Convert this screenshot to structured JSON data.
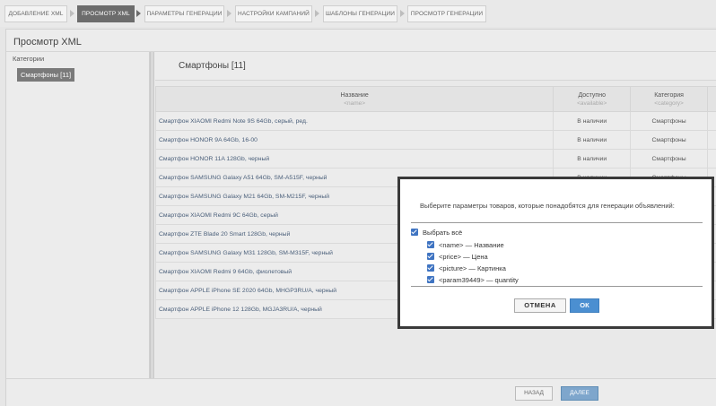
{
  "steps": [
    {
      "label": "ДОБАВЛЕНИЕ XML",
      "active": false
    },
    {
      "label": "ПРОСМОТР XML",
      "active": true
    },
    {
      "label": "ПАРАМЕТРЫ ГЕНЕРАЦИИ",
      "active": false
    },
    {
      "label": "НАСТРОЙКИ КАМПАНИЙ",
      "active": false
    },
    {
      "label": "ШАБЛОНЫ ГЕНЕРАЦИИ",
      "active": false
    },
    {
      "label": "ПРОСМОТР ГЕНЕРАЦИИ",
      "active": false
    }
  ],
  "page_title": "Просмотр XML",
  "sidebar": {
    "label": "Категории",
    "selected_category": "Смартфоны [11]"
  },
  "content": {
    "title": "Смартфоны [11]",
    "columns": [
      {
        "label": "Название",
        "tag": "<name>"
      },
      {
        "label": "Доступно",
        "tag": "<available>"
      },
      {
        "label": "Категория",
        "tag": "<category>"
      }
    ],
    "rows": [
      {
        "name": "Смартфон XIAOMI Redmi Note 9S 64Gb, серый, ред.",
        "available": "В наличии",
        "category": "Смартфоны"
      },
      {
        "name": "Смартфон HONOR 9A 64Gb, 16-00",
        "available": "В наличии",
        "category": "Смартфоны"
      },
      {
        "name": "Смартфон HONOR 11A 128Gb, черный",
        "available": "В наличии",
        "category": "Смартфоны"
      },
      {
        "name": "Смартфон SAMSUNG Galaxy A51 64Gb, SM-A515F, черный",
        "available": "В наличии",
        "category": "Смартфоны"
      },
      {
        "name": "Смартфон SAMSUNG Galaxy M21 64Gb, SM-M215F, черный",
        "available": "",
        "category": ""
      },
      {
        "name": "Смартфон XIAOMI Redmi 9C 64Gb, серый",
        "available": "",
        "category": ""
      },
      {
        "name": "Смартфон ZTE Blade 20 Smart 128Gb, черный",
        "available": "",
        "category": ""
      },
      {
        "name": "Смартфон SAMSUNG Galaxy M31 128Gb, SM-M315F, черный",
        "available": "",
        "category": ""
      },
      {
        "name": "Смартфон XIAOMI Redmi 9 64Gb, фиолетовый",
        "available": "",
        "category": ""
      },
      {
        "name": "Смартфон APPLE iPhone SE 2020 64Gb, MHGP3RU/A, черный",
        "available": "",
        "category": ""
      },
      {
        "name": "Смартфон APPLE iPhone 12 128Gb, MGJA3RU/A, черный",
        "available": "",
        "category": ""
      }
    ]
  },
  "footer": {
    "back_label": "НАЗАД",
    "next_label": "ДАЛЕЕ"
  },
  "modal": {
    "message": "Выберите параметры товаров, которые понадобятся для генерации объявлений:",
    "select_all_label": "Выбрать всё",
    "options": [
      {
        "label": "<name> — Название",
        "checked": true
      },
      {
        "label": "<price> — Цена",
        "checked": true
      },
      {
        "label": "<picture> — Картинка",
        "checked": true
      },
      {
        "label": "<param39449> — quantity",
        "checked": true
      }
    ],
    "cancel_label": "ОТМЕНА",
    "ok_label": "ОК"
  }
}
